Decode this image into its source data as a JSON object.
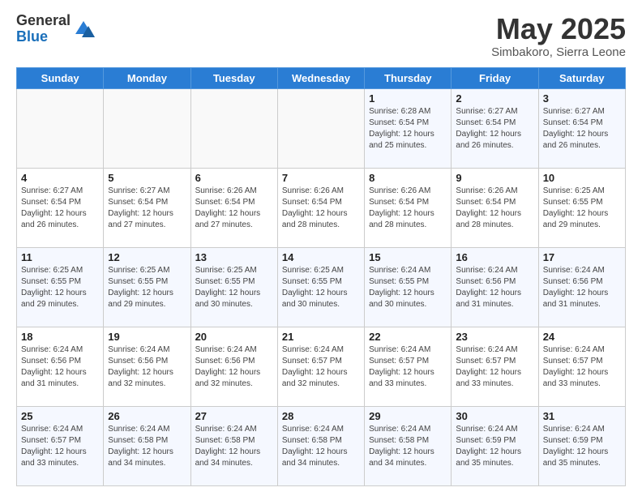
{
  "logo": {
    "general": "General",
    "blue": "Blue"
  },
  "title": "May 2025",
  "subtitle": "Simbakoro, Sierra Leone",
  "days_header": [
    "Sunday",
    "Monday",
    "Tuesday",
    "Wednesday",
    "Thursday",
    "Friday",
    "Saturday"
  ],
  "weeks": [
    [
      {
        "day": "",
        "info": ""
      },
      {
        "day": "",
        "info": ""
      },
      {
        "day": "",
        "info": ""
      },
      {
        "day": "",
        "info": ""
      },
      {
        "day": "1",
        "info": "Sunrise: 6:28 AM\nSunset: 6:54 PM\nDaylight: 12 hours and 25 minutes."
      },
      {
        "day": "2",
        "info": "Sunrise: 6:27 AM\nSunset: 6:54 PM\nDaylight: 12 hours and 26 minutes."
      },
      {
        "day": "3",
        "info": "Sunrise: 6:27 AM\nSunset: 6:54 PM\nDaylight: 12 hours and 26 minutes."
      }
    ],
    [
      {
        "day": "4",
        "info": "Sunrise: 6:27 AM\nSunset: 6:54 PM\nDaylight: 12 hours and 26 minutes."
      },
      {
        "day": "5",
        "info": "Sunrise: 6:27 AM\nSunset: 6:54 PM\nDaylight: 12 hours and 27 minutes."
      },
      {
        "day": "6",
        "info": "Sunrise: 6:26 AM\nSunset: 6:54 PM\nDaylight: 12 hours and 27 minutes."
      },
      {
        "day": "7",
        "info": "Sunrise: 6:26 AM\nSunset: 6:54 PM\nDaylight: 12 hours and 28 minutes."
      },
      {
        "day": "8",
        "info": "Sunrise: 6:26 AM\nSunset: 6:54 PM\nDaylight: 12 hours and 28 minutes."
      },
      {
        "day": "9",
        "info": "Sunrise: 6:26 AM\nSunset: 6:54 PM\nDaylight: 12 hours and 28 minutes."
      },
      {
        "day": "10",
        "info": "Sunrise: 6:25 AM\nSunset: 6:55 PM\nDaylight: 12 hours and 29 minutes."
      }
    ],
    [
      {
        "day": "11",
        "info": "Sunrise: 6:25 AM\nSunset: 6:55 PM\nDaylight: 12 hours and 29 minutes."
      },
      {
        "day": "12",
        "info": "Sunrise: 6:25 AM\nSunset: 6:55 PM\nDaylight: 12 hours and 29 minutes."
      },
      {
        "day": "13",
        "info": "Sunrise: 6:25 AM\nSunset: 6:55 PM\nDaylight: 12 hours and 30 minutes."
      },
      {
        "day": "14",
        "info": "Sunrise: 6:25 AM\nSunset: 6:55 PM\nDaylight: 12 hours and 30 minutes."
      },
      {
        "day": "15",
        "info": "Sunrise: 6:24 AM\nSunset: 6:55 PM\nDaylight: 12 hours and 30 minutes."
      },
      {
        "day": "16",
        "info": "Sunrise: 6:24 AM\nSunset: 6:56 PM\nDaylight: 12 hours and 31 minutes."
      },
      {
        "day": "17",
        "info": "Sunrise: 6:24 AM\nSunset: 6:56 PM\nDaylight: 12 hours and 31 minutes."
      }
    ],
    [
      {
        "day": "18",
        "info": "Sunrise: 6:24 AM\nSunset: 6:56 PM\nDaylight: 12 hours and 31 minutes."
      },
      {
        "day": "19",
        "info": "Sunrise: 6:24 AM\nSunset: 6:56 PM\nDaylight: 12 hours and 32 minutes."
      },
      {
        "day": "20",
        "info": "Sunrise: 6:24 AM\nSunset: 6:56 PM\nDaylight: 12 hours and 32 minutes."
      },
      {
        "day": "21",
        "info": "Sunrise: 6:24 AM\nSunset: 6:57 PM\nDaylight: 12 hours and 32 minutes."
      },
      {
        "day": "22",
        "info": "Sunrise: 6:24 AM\nSunset: 6:57 PM\nDaylight: 12 hours and 33 minutes."
      },
      {
        "day": "23",
        "info": "Sunrise: 6:24 AM\nSunset: 6:57 PM\nDaylight: 12 hours and 33 minutes."
      },
      {
        "day": "24",
        "info": "Sunrise: 6:24 AM\nSunset: 6:57 PM\nDaylight: 12 hours and 33 minutes."
      }
    ],
    [
      {
        "day": "25",
        "info": "Sunrise: 6:24 AM\nSunset: 6:57 PM\nDaylight: 12 hours and 33 minutes."
      },
      {
        "day": "26",
        "info": "Sunrise: 6:24 AM\nSunset: 6:58 PM\nDaylight: 12 hours and 34 minutes."
      },
      {
        "day": "27",
        "info": "Sunrise: 6:24 AM\nSunset: 6:58 PM\nDaylight: 12 hours and 34 minutes."
      },
      {
        "day": "28",
        "info": "Sunrise: 6:24 AM\nSunset: 6:58 PM\nDaylight: 12 hours and 34 minutes."
      },
      {
        "day": "29",
        "info": "Sunrise: 6:24 AM\nSunset: 6:58 PM\nDaylight: 12 hours and 34 minutes."
      },
      {
        "day": "30",
        "info": "Sunrise: 6:24 AM\nSunset: 6:59 PM\nDaylight: 12 hours and 35 minutes."
      },
      {
        "day": "31",
        "info": "Sunrise: 6:24 AM\nSunset: 6:59 PM\nDaylight: 12 hours and 35 minutes."
      }
    ]
  ]
}
